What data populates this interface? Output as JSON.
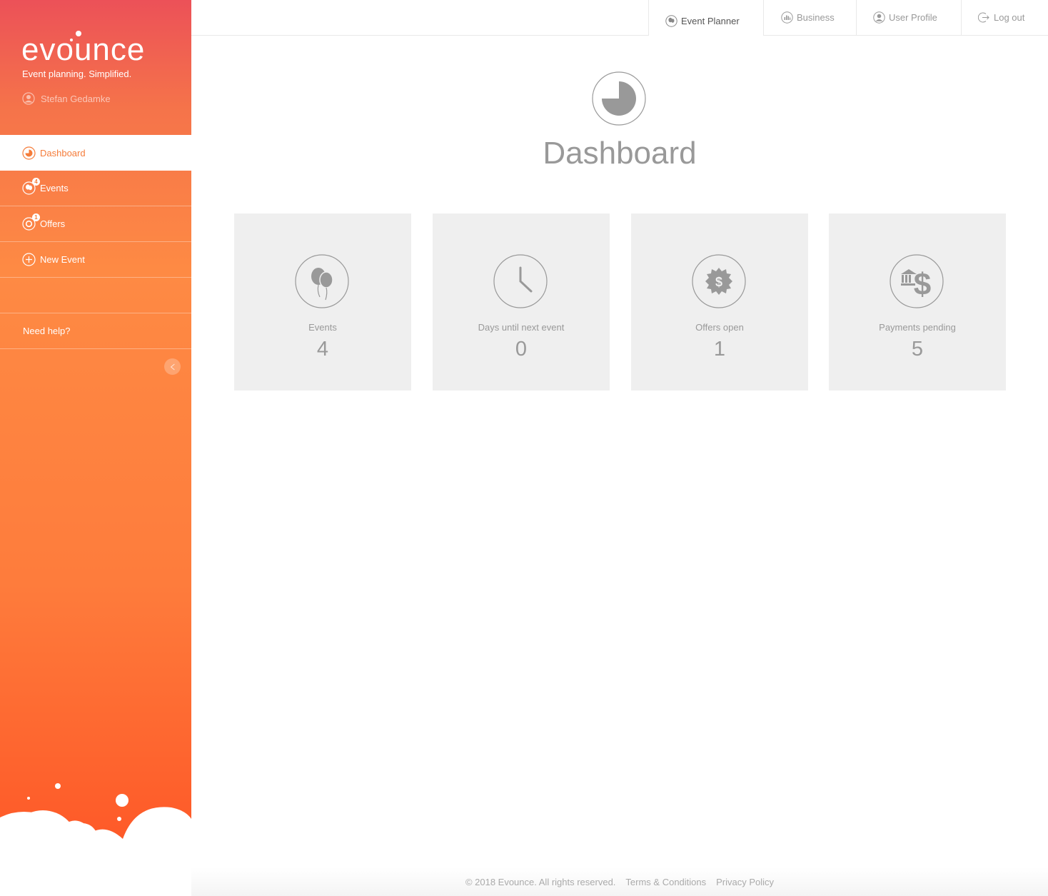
{
  "brand": {
    "logo_text": "evounce",
    "tagline": "Event planning. Simplified.",
    "user_name": "Stefan Gedamke",
    "accent": "#f57c3a"
  },
  "sidebar": {
    "items": [
      {
        "label": "Dashboard",
        "icon": "dashboard-icon",
        "active": true
      },
      {
        "label": "Events",
        "icon": "balloon-icon",
        "badge": "4"
      },
      {
        "label": "Offers",
        "icon": "offer-icon",
        "badge": "1"
      },
      {
        "label": "New Event",
        "icon": "plus-circle-icon"
      },
      {
        "label": ""
      },
      {
        "label": "Need help?"
      }
    ]
  },
  "topnav": {
    "tabs": [
      {
        "label": "Event Planner",
        "icon": "balloon-icon",
        "active": true
      },
      {
        "label": "Business",
        "icon": "bar-chart-icon"
      },
      {
        "label": "User Profile",
        "icon": "user-icon"
      },
      {
        "label": "Log out",
        "icon": "logout-icon"
      }
    ]
  },
  "main": {
    "title": "Dashboard",
    "cards": [
      {
        "label": "Events",
        "value": "4",
        "icon": "balloons-icon"
      },
      {
        "label": "Days until next event",
        "value": "0",
        "icon": "clock-icon"
      },
      {
        "label": "Offers open",
        "value": "1",
        "icon": "dollar-badge-icon"
      },
      {
        "label": "Payments pending",
        "value": "5",
        "icon": "bank-dollar-icon"
      }
    ]
  },
  "footer": {
    "copyright": "© 2018 Evounce. All rights reserved.",
    "terms": "Terms & Conditions",
    "privacy": "Privacy Policy"
  }
}
